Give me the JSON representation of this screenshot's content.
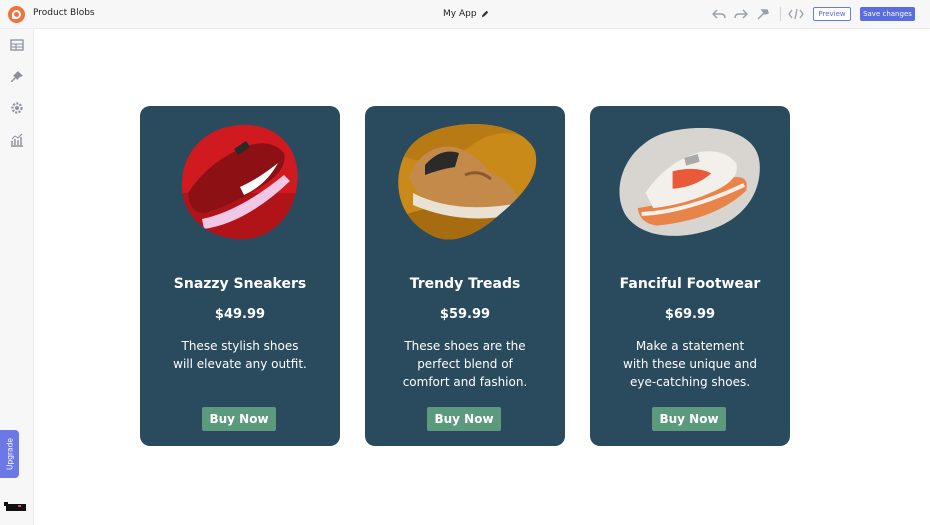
{
  "topbar": {
    "app_title": "Product Blobs",
    "center_title": "My App",
    "preview_label": "Preview",
    "save_label": "Save changes"
  },
  "sidebar": {
    "items": [
      {
        "icon": "table-icon"
      },
      {
        "icon": "pin-icon"
      },
      {
        "icon": "gear-icon"
      },
      {
        "icon": "analytics-icon"
      }
    ],
    "upgrade_label": "Upgrade"
  },
  "colors": {
    "card_bg": "#2a4a5e",
    "button_bg": "#5c9a7e",
    "accent": "#5a6ee0",
    "logo": "#f0723e"
  },
  "cards": [
    {
      "title": "Snazzy Sneakers",
      "price": "$49.99",
      "desc_lines": [
        "These stylish shoes",
        "will elevate any outfit."
      ],
      "button": "Buy Now"
    },
    {
      "title": "Trendy Treads",
      "price": "$59.99",
      "desc_lines": [
        "These shoes are the",
        "perfect blend of",
        "comfort and fashion."
      ],
      "button": "Buy Now"
    },
    {
      "title": "Fanciful Footwear",
      "price": "$69.99",
      "desc_lines": [
        "Make a statement",
        "with these unique and",
        "eye-catching shoes."
      ],
      "button": "Buy Now"
    }
  ]
}
